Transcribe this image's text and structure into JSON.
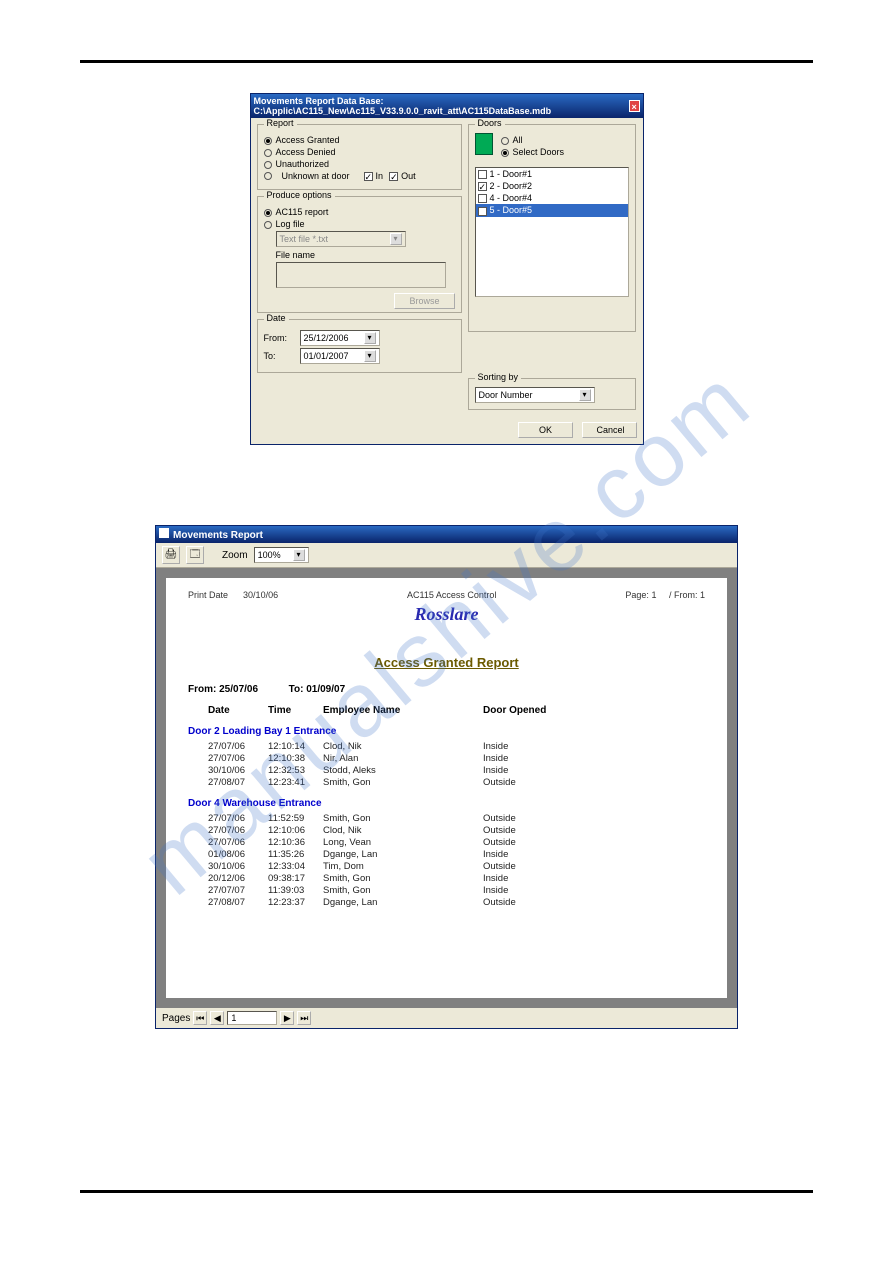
{
  "dialog1": {
    "title": "Movements Report  Data Base: C:\\Applic\\AC115_New\\Ac115_V33.9.0.0_ravit_att\\AC115DataBase.mdb",
    "report_group_label": "Report",
    "radios": {
      "access_granted": "Access Granted",
      "access_denied": "Access Denied",
      "unauthorized": "Unauthorized",
      "unknown": "Unknown at door"
    },
    "chk_in": "In",
    "chk_out": "Out",
    "produce_group_label": "Produce options",
    "produce": {
      "ac115": "AC115 report",
      "log": "Log file",
      "filetype": "Text file *.txt",
      "filename_label": "File name",
      "browse": "Browse"
    },
    "date_group_label": "Date",
    "date_from_label": "From:",
    "date_from": "25/12/2006",
    "date_to_label": "To:",
    "date_to": "01/01/2007",
    "doors_group_label": "Doors",
    "doors_all": "All",
    "doors_select": "Select Doors",
    "door_items": [
      {
        "n": "1",
        "label": "1 - Door#1",
        "checked": false
      },
      {
        "n": "2",
        "label": "2 - Door#2",
        "checked": true
      },
      {
        "n": "4",
        "label": "4 - Door#4",
        "checked": false
      },
      {
        "n": "5",
        "label": "5 - Door#5",
        "checked": true,
        "selected": true
      }
    ],
    "sorting_group_label": "Sorting by",
    "sorting_value": "Door Number",
    "ok": "OK",
    "cancel": "Cancel"
  },
  "report": {
    "title": "Movements Report",
    "zoom_label": "Zoom",
    "zoom_value": "100%",
    "print_date_label": "Print Date",
    "print_date": "30/10/06",
    "subtitle": "AC115 Access Control",
    "page_label": "Page:",
    "page_num": "1",
    "from_label": "/ From:",
    "from_num": "1",
    "brand": "Rosslare",
    "report_title": "Access Granted Report",
    "range_from_label": "From:",
    "range_from": "25/07/06",
    "range_to_label": "To:",
    "range_to": "01/09/07",
    "cols": {
      "date": "Date",
      "time": "Time",
      "emp": "Employee Name",
      "opened": "Door Opened"
    },
    "sections": [
      {
        "id": "2",
        "header": "Door  2        Loading Bay 1 Entrance",
        "rows": [
          {
            "date": "27/07/06",
            "time": "12:10:14",
            "emp": "Clod, Nik",
            "open": "Inside"
          },
          {
            "date": "27/07/06",
            "time": "12:10:38",
            "emp": "Nir, Alan",
            "open": "Inside"
          },
          {
            "date": "30/10/06",
            "time": "12:32:53",
            "emp": "Stodd, Aleks",
            "open": "Inside"
          },
          {
            "date": "27/08/07",
            "time": "12:23:41",
            "emp": "Smith, Gon",
            "open": "Outside"
          }
        ]
      },
      {
        "id": "4",
        "header": "Door  4        Warehouse Entrance",
        "rows": [
          {
            "date": "27/07/06",
            "time": "11:52:59",
            "emp": "Smith, Gon",
            "open": "Outside"
          },
          {
            "date": "27/07/06",
            "time": "12:10:06",
            "emp": "Clod, Nik",
            "open": "Outside"
          },
          {
            "date": "27/07/06",
            "time": "12:10:36",
            "emp": "Long, Vean",
            "open": "Outside"
          },
          {
            "date": "01/08/06",
            "time": "11:35:26",
            "emp": "Dgange, Lan",
            "open": "Inside"
          },
          {
            "date": "30/10/06",
            "time": "12:33:04",
            "emp": "Tim, Dom",
            "open": "Outside"
          },
          {
            "date": "20/12/06",
            "time": "09:38:17",
            "emp": "Smith, Gon",
            "open": "Inside"
          },
          {
            "date": "27/07/07",
            "time": "11:39:03",
            "emp": "Smith, Gon",
            "open": "Inside"
          },
          {
            "date": "27/08/07",
            "time": "12:23:37",
            "emp": "Dgange, Lan",
            "open": "Outside"
          }
        ]
      }
    ],
    "pager_label": "Pages",
    "pager_value": "1"
  },
  "watermark": "manualshive.com"
}
